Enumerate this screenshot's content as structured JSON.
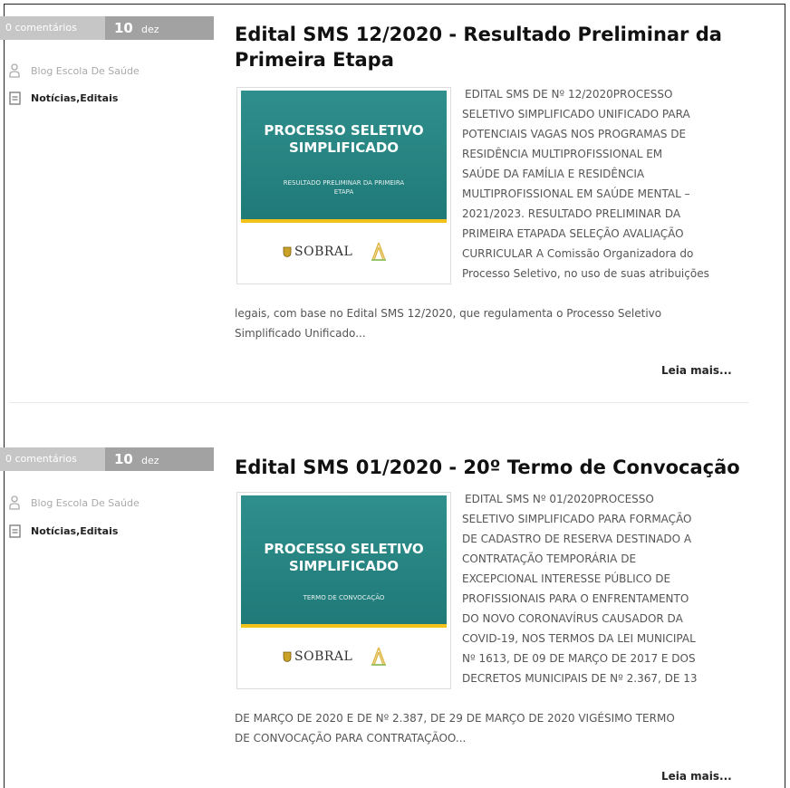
{
  "posts": [
    {
      "comments": "0 comentários",
      "date_day": "10",
      "date_month": "dez",
      "author": "Blog Escola De Saúde",
      "categories": [
        "Notícias",
        "Editais"
      ],
      "title_lines": [
        "Edital SMS 12/2020 - Resultado Preliminar da",
        "Primeira Etapa"
      ],
      "thumb": {
        "line1": "PROCESSO SELETIVO",
        "line2": "SIMPLIFICADO",
        "sub": "RESULTADO PRELIMINAR DA PRIMEIRA ETAPA",
        "logo_text": "SOBRAL"
      },
      "excerpt_side": [
        "EDITAL SMS DE Nº 12/2020PROCESSO",
        "SELETIVO SIMPLIFICADO UNIFICADO PARA",
        "POTENCIAIS VAGAS NOS PROGRAMAS DE",
        "RESIDÊNCIA MULTIPROFISSIONAL EM",
        "SAÚDE DA FAMÍLIA E RESIDÊNCIA",
        "MULTIPROFISSIONAL EM SAÚDE MENTAL –",
        "2021/2023. RESULTADO PRELIMINAR DA",
        "PRIMEIRA ETAPADA SELEÇÃO AVALIAÇÃO",
        "CURRICULAR A Comissão Organizadora do",
        "Processo Seletivo, no uso de suas atribuições"
      ],
      "excerpt_full": [
        "legais, com base no Edital SMS 12/2020, que regulamenta o Processo Seletivo",
        "Simplificado Unificado..."
      ],
      "read_more": "Leia mais..."
    },
    {
      "comments": "0 comentários",
      "date_day": "10",
      "date_month": "dez",
      "author": "Blog Escola De Saúde",
      "categories": [
        "Notícias",
        "Editais"
      ],
      "title_lines": [
        "Edital SMS 01/2020 - 20º Termo de Convocação"
      ],
      "thumb": {
        "line1": "PROCESSO SELETIVO",
        "line2": "SIMPLIFICADO",
        "sub": "TERMO DE CONVOCAÇÃO",
        "logo_text": "SOBRAL"
      },
      "excerpt_side": [
        "EDITAL SMS Nº 01/2020PROCESSO",
        "SELETIVO SIMPLIFICADO PARA FORMAÇÃO",
        "DE CADASTRO DE RESERVA DESTINADO A",
        "CONTRATAÇÃO TEMPORÁRIA DE",
        "EXCEPCIONAL INTERESSE PÚBLICO DE",
        "PROFISSIONAIS PARA O ENFRENTAMENTO",
        "DO NOVO CORONAVÍRUS CAUSADOR DA",
        "COVID-19, NOS TERMOS DA LEI MUNICIPAL",
        "Nº 1613, DE 09 DE MARÇO DE 2017 E DOS",
        "DECRETOS MUNICIPAIS DE Nº 2.367, DE 13"
      ],
      "excerpt_full": [
        "DE MARÇO DE 2020 E DE Nº 2.387, DE 29 DE MARÇO DE 2020 VIGÉSIMO TERMO",
        "DE CONVOCAÇÃO PARA CONTRATAÇÃOO..."
      ],
      "read_more": "Leia mais..."
    }
  ],
  "colors": {
    "thumb_teal": "#23807e",
    "thumb_yellow": "#f2c21b",
    "meta_comments_bg": "#c6c6c6",
    "meta_date_bg": "#a2a2a2"
  },
  "icons": {
    "author": "user-icon",
    "categories": "folder-icon"
  }
}
